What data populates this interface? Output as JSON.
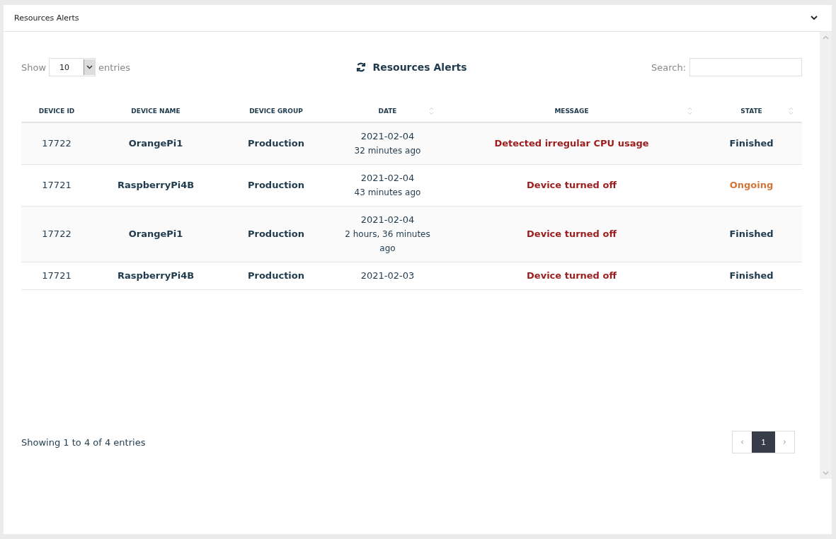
{
  "panel": {
    "title": "Resources Alerts",
    "expanded": true
  },
  "length_menu": {
    "label_before": "Show",
    "value": "10",
    "label_after": "entries"
  },
  "table_title": "Resources Alerts",
  "search": {
    "label": "Search:"
  },
  "table": {
    "columns": [
      {
        "label": "DEVICE ID",
        "sortable": false
      },
      {
        "label": "DEVICE NAME",
        "sortable": false
      },
      {
        "label": "DEVICE GROUP",
        "sortable": false
      },
      {
        "label": "DATE",
        "sortable": true
      },
      {
        "label": "MESSAGE",
        "sortable": true
      },
      {
        "label": "STATE",
        "sortable": true
      }
    ],
    "rows": [
      {
        "device_id": "17722",
        "device_name": "OrangePi1",
        "device_group": "Production",
        "date": "2021-02-04",
        "ago": "32 minutes ago",
        "message": "Detected irregular CPU usage",
        "state": "Finished",
        "color": "#1f3a4d"
      },
      {
        "device_id": "17721",
        "device_name": "RaspberryPi4B",
        "device_group": "Production",
        "date": "2021-02-04",
        "ago": "43 minutes ago",
        "message": "Device turned off",
        "state": "Ongoing",
        "color": "#d2773a"
      },
      {
        "device_id": "17722",
        "device_name": "OrangePi1",
        "device_group": "Production",
        "date": "2021-02-04",
        "ago": "2 hours, 36 minutes ago",
        "message": "Device turned off",
        "state": "Finished",
        "color": "#1f3a4d"
      },
      {
        "device_id": "17721",
        "device_name": "RaspberryPi4B",
        "device_group": "Production",
        "date": "2021-02-03",
        "message": "Device turned off",
        "state": "Finished",
        "color": "#1f3a4d"
      }
    ]
  },
  "info": "Showing 1 to 4 of 4 entries",
  "pagination": {
    "pages": [
      {
        "label": "1",
        "selected": true
      }
    ]
  }
}
